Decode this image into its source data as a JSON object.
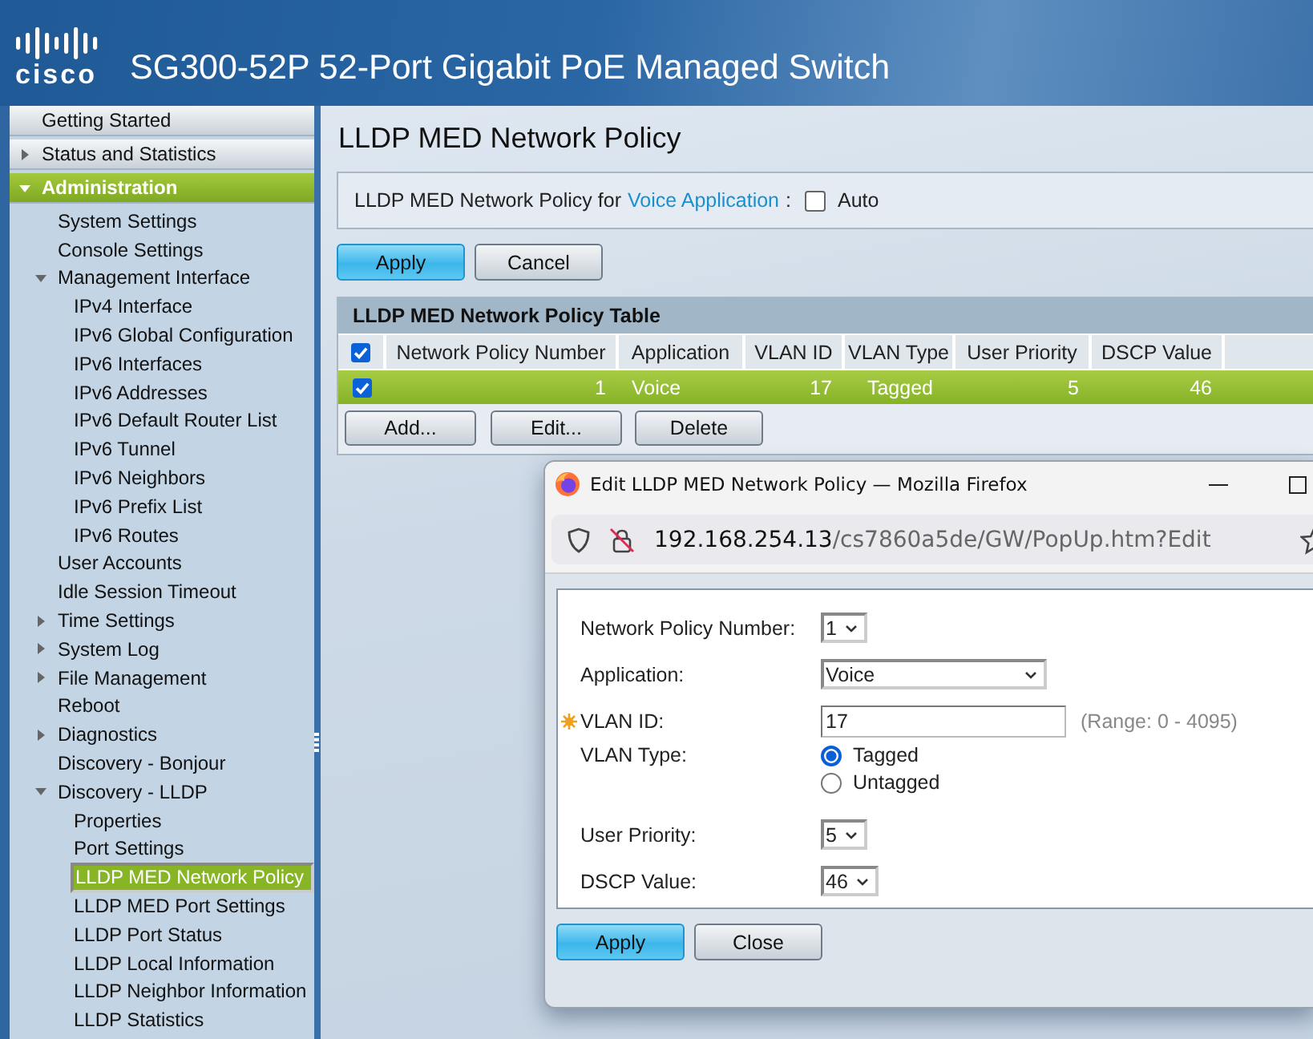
{
  "header": {
    "logo_text": "cisco",
    "title": "SG300-52P 52-Port Gigabit PoE Managed Switch"
  },
  "sidebar": {
    "items": [
      {
        "label": "Getting Started",
        "selected": false
      },
      {
        "label": "Status and Statistics",
        "selected": false,
        "expanded": false
      },
      {
        "label": "Administration",
        "selected": true,
        "expanded": true,
        "children": [
          {
            "label": "System Settings",
            "selected": false
          },
          {
            "label": "Console Settings",
            "selected": false
          },
          {
            "label": "Management Interface",
            "selected": false,
            "expanded": true,
            "children": [
              {
                "label": "IPv4 Interface",
                "selected": false
              },
              {
                "label": "IPv6 Global Configuration",
                "selected": false
              },
              {
                "label": "IPv6 Interfaces",
                "selected": false
              },
              {
                "label": "IPv6 Addresses",
                "selected": false
              },
              {
                "label": "IPv6 Default Router List",
                "selected": false
              },
              {
                "label": "IPv6 Tunnel",
                "selected": false
              },
              {
                "label": "IPv6 Neighbors",
                "selected": false
              },
              {
                "label": "IPv6 Prefix List",
                "selected": false
              },
              {
                "label": "IPv6 Routes",
                "selected": false
              }
            ]
          },
          {
            "label": "User Accounts",
            "selected": false
          },
          {
            "label": "Idle Session Timeout",
            "selected": false
          },
          {
            "label": "Time Settings",
            "selected": false,
            "expanded": false
          },
          {
            "label": "System Log",
            "selected": false,
            "expanded": false
          },
          {
            "label": "File Management",
            "selected": false,
            "expanded": false
          },
          {
            "label": "Reboot",
            "selected": false
          },
          {
            "label": "Diagnostics",
            "selected": false,
            "expanded": false
          },
          {
            "label": "Discovery - Bonjour",
            "selected": false
          },
          {
            "label": "Discovery - LLDP",
            "selected": false,
            "expanded": true,
            "children": [
              {
                "label": "Properties",
                "selected": false
              },
              {
                "label": "Port Settings",
                "selected": false
              },
              {
                "label": "LLDP MED Network Policy",
                "selected": true
              },
              {
                "label": "LLDP MED Port Settings",
                "selected": false
              },
              {
                "label": "LLDP Port Status",
                "selected": false
              },
              {
                "label": "LLDP Local Information",
                "selected": false
              },
              {
                "label": "LLDP Neighbor Information",
                "selected": false
              },
              {
                "label": "LLDP Statistics",
                "selected": false
              }
            ]
          }
        ]
      }
    ]
  },
  "page": {
    "title": "LLDP MED Network Policy",
    "voice_policy": {
      "label": "LLDP MED Network Policy for",
      "link": "Voice Application",
      "separator": ":",
      "auto": {
        "label": "Auto",
        "checked": false
      }
    },
    "buttons": [
      {
        "label": "Apply",
        "kind": "primary"
      },
      {
        "label": "Cancel",
        "kind": "secondary"
      }
    ],
    "table": {
      "title": "LLDP MED Network Policy Table",
      "all_checked": true,
      "columns": [
        {
          "label": "Network Policy Number",
          "kind": "number"
        },
        {
          "label": "Application",
          "kind": "text"
        },
        {
          "label": "VLAN ID",
          "kind": "number"
        },
        {
          "label": "VLAN Type",
          "kind": "centered"
        },
        {
          "label": "User Priority",
          "kind": "number"
        },
        {
          "label": "DSCP Value",
          "kind": "number"
        }
      ],
      "rows": [
        {
          "selected": true,
          "checked": true,
          "cells": [
            "1",
            "Voice",
            "17",
            "Tagged",
            "5",
            "46"
          ]
        }
      ],
      "buttons": [
        "Add...",
        "Edit...",
        "Delete"
      ]
    }
  },
  "popup": {
    "title": "Edit LLDP MED Network Policy — Mozilla Firefox",
    "url": {
      "host": "192.168.254.13",
      "path": "/cs7860a5de/GW/PopUp.htm?Edit"
    },
    "fields": [
      {
        "kind": "select",
        "label": "Network Policy Number:",
        "value": "1"
      },
      {
        "kind": "wide-select",
        "label": "Application:",
        "value": "Voice"
      },
      {
        "kind": "text",
        "label": "VLAN ID:",
        "required": true,
        "value": "17",
        "hint": "(Range: 0 - 4095)"
      },
      {
        "kind": "radio",
        "label": "VLAN Type:",
        "options": [
          {
            "label": "Tagged",
            "selected": true
          },
          {
            "label": "Untagged",
            "selected": false
          }
        ]
      },
      {
        "kind": "select",
        "label": "User Priority:",
        "value": "5"
      },
      {
        "kind": "select",
        "label": "DSCP Value:",
        "value": "46"
      }
    ],
    "buttons": [
      {
        "label": "Apply",
        "kind": "primary"
      },
      {
        "label": "Close",
        "kind": "secondary"
      }
    ]
  }
}
